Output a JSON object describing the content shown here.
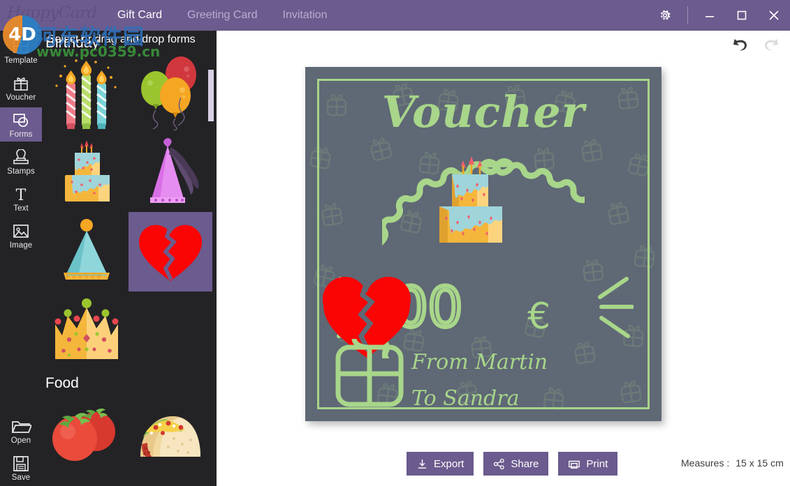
{
  "titlebar": {
    "brand": "HappyCard",
    "tabs": [
      {
        "label": "Gift Card",
        "active": true
      },
      {
        "label": "Greeting Card",
        "active": false
      },
      {
        "label": "Invitation",
        "active": false
      }
    ],
    "settings_icon": "gear-icon",
    "minimize_icon": "minimize-icon",
    "maximize_icon": "maximize-icon",
    "close_icon": "close-icon",
    "accent": "#6b5b8e"
  },
  "rail": {
    "items": [
      {
        "label": "Template",
        "icon": "template-icon",
        "selected": false
      },
      {
        "label": "Voucher",
        "icon": "gift-icon",
        "selected": false
      },
      {
        "label": "Forms",
        "icon": "shapes-icon",
        "selected": true
      },
      {
        "label": "Stamps",
        "icon": "stamp-icon",
        "selected": false
      },
      {
        "label": "Text",
        "icon": "text-icon",
        "selected": false
      },
      {
        "label": "Image",
        "icon": "image-icon",
        "selected": false
      }
    ],
    "bottom": [
      {
        "label": "Open",
        "icon": "folder-icon"
      },
      {
        "label": "Save",
        "icon": "floppy-disk-icon"
      }
    ],
    "selected_color": "#6b5b8e"
  },
  "panel": {
    "header": "Select or drag and drop forms",
    "collapse_icon": "chevron-left-icon",
    "sections": [
      {
        "title": "Birthday",
        "items": [
          {
            "name": "birthday-candles",
            "selected": false
          },
          {
            "name": "balloons",
            "selected": false
          },
          {
            "name": "birthday-cake",
            "selected": false
          },
          {
            "name": "party-hat-pink",
            "selected": false
          },
          {
            "name": "party-hat-teal",
            "selected": false
          },
          {
            "name": "broken-heart",
            "selected": true
          }
        ]
      },
      {
        "title": "Food",
        "items": [
          {
            "name": "tomatoes",
            "selected": false
          },
          {
            "name": "taco",
            "selected": false
          }
        ]
      }
    ],
    "extra_items": [
      {
        "name": "crown",
        "selected": false
      }
    ]
  },
  "toolbar": {
    "undo_icon": "undo-icon",
    "redo_icon": "redo-icon",
    "undo_enabled": true,
    "redo_enabled": false
  },
  "card": {
    "title": "Voucher",
    "amount": "00",
    "currency": "€",
    "from_line": "From Martin",
    "to_line": "To Sandra",
    "background": "#5f6875",
    "accent": "#a8d68a",
    "decor": [
      "birthday-cake",
      "broken-heart",
      "gift-box-outline",
      "scalloped-badge",
      "gift-pattern"
    ]
  },
  "actions": {
    "buttons": [
      {
        "label": "Export",
        "icon": "download-icon"
      },
      {
        "label": "Share",
        "icon": "share-icon"
      },
      {
        "label": "Print",
        "icon": "printer-icon"
      }
    ],
    "measures_label": "Measures :",
    "measures_value": "15 x 15 cm"
  },
  "watermark": {
    "logo_text": "4D",
    "site_cn": "河东软件园",
    "site_url": "www.pc0359.cn"
  }
}
